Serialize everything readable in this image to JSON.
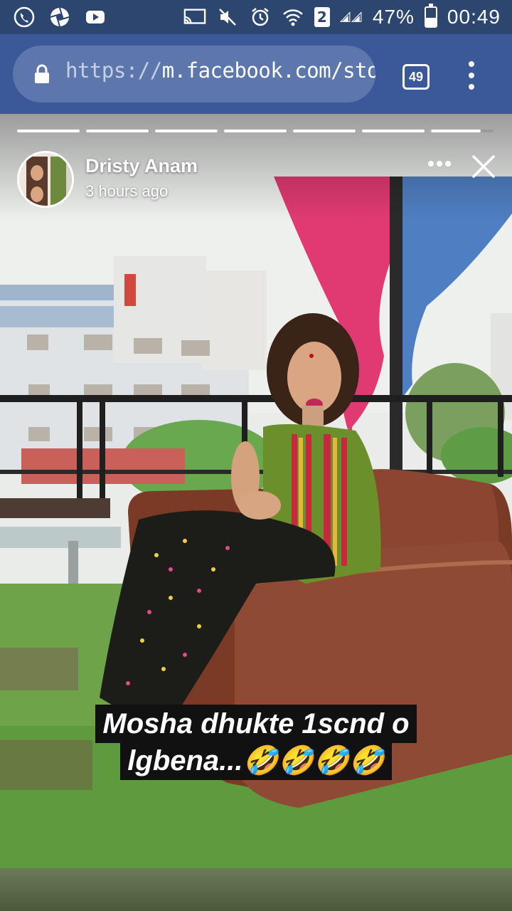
{
  "status_bar": {
    "left_icons": [
      "phone-icon",
      "camera-shutter-icon",
      "youtube-icon"
    ],
    "right_icons": [
      "cast-icon",
      "mute-icon",
      "alarm-icon",
      "wifi-icon",
      "sim-icon",
      "signal-icon",
      "battery-icon"
    ],
    "sim_label": "2",
    "battery": "47%",
    "battery_level": 0.47,
    "time": "00:49"
  },
  "browser": {
    "url_scheme": "https://",
    "url_rest": "m.facebook.com/storie",
    "tab_count": "49",
    "menu_icon": "kebab-menu-icon",
    "lock_icon": "lock-icon",
    "toolbar_color": "#3b5998"
  },
  "story": {
    "segments_total": 7,
    "author": "Dristy Anam",
    "time_ago": "3 hours ago",
    "more_icon": "more-dots-icon",
    "close_icon": "close-icon",
    "caption_line1": "Mosha dhukte 1scnd o",
    "caption_line2": "lgbena...🤣🤣🤣🤣"
  }
}
